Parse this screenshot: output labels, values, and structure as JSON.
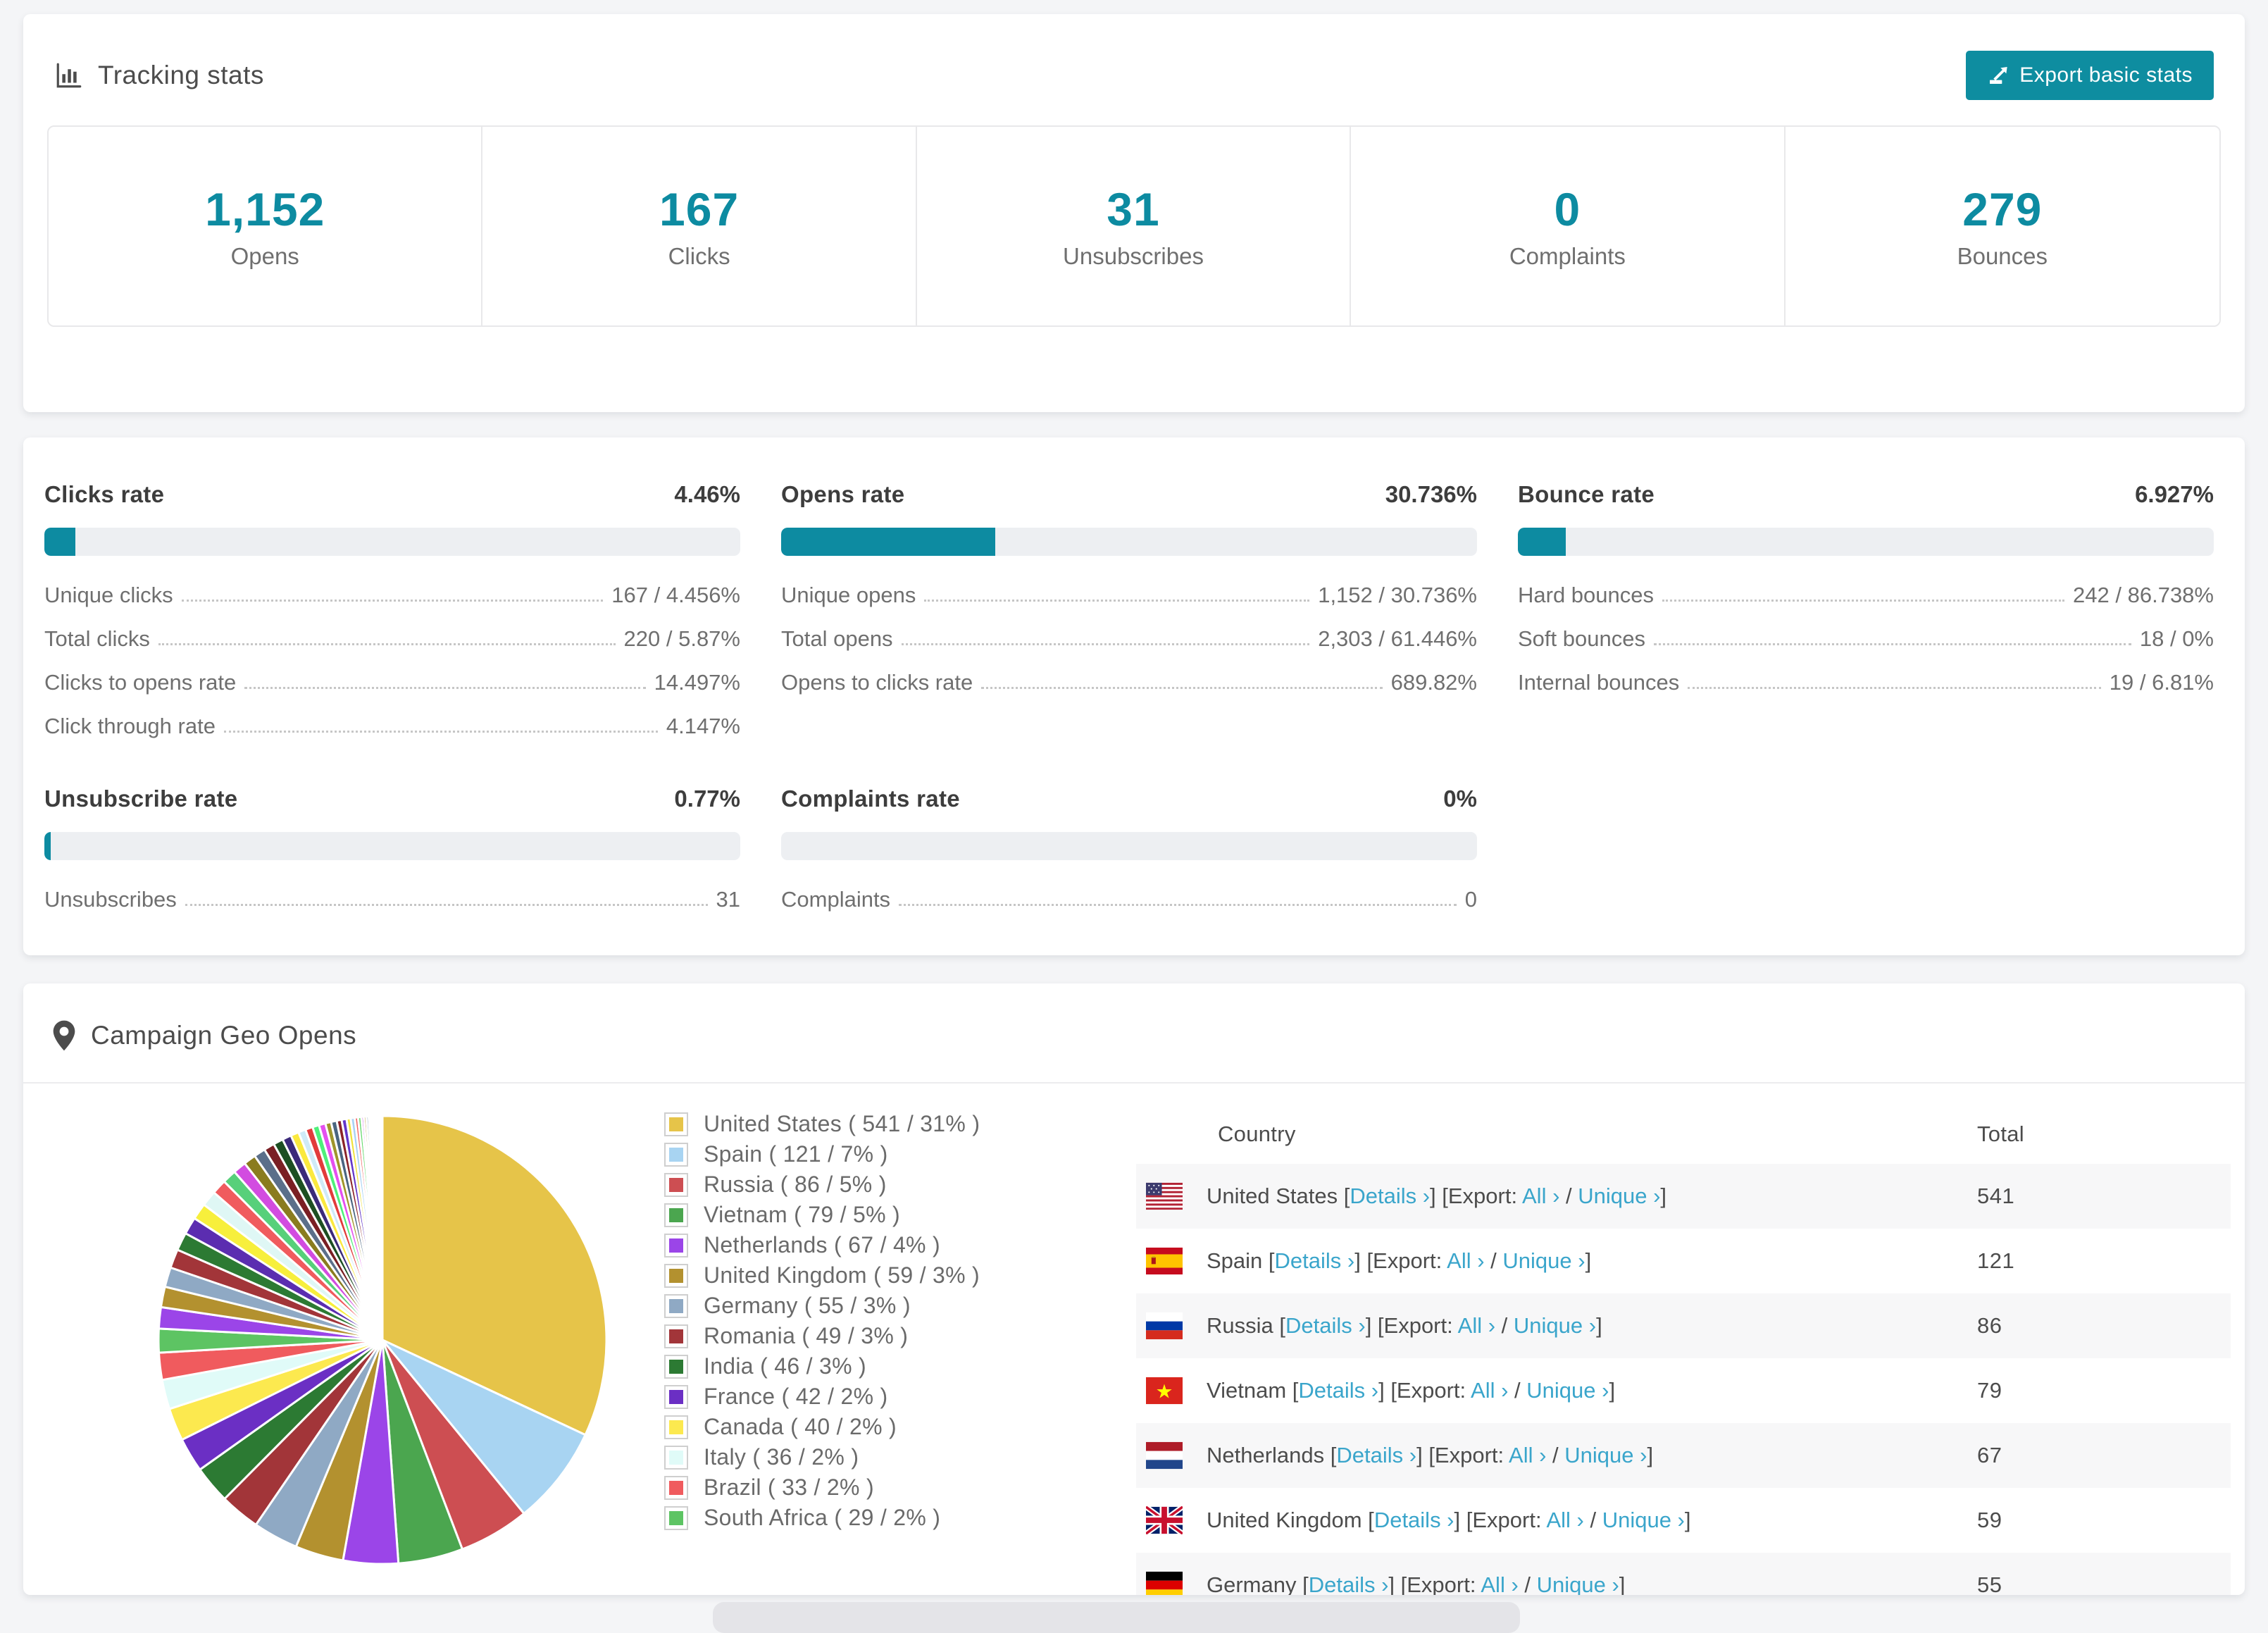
{
  "colors": {
    "accent_teal": "#0d8ba1",
    "button_teal": "#0e8da0",
    "link_blue": "#3aa5cb",
    "bar_track": "#edeff2",
    "page_bg": "#f4f5f7",
    "stripe_bg": "#f7f7f8"
  },
  "tracking_card": {
    "title": "Tracking stats",
    "export_button": "Export basic stats",
    "stats": [
      {
        "value": "1,152",
        "label": "Opens"
      },
      {
        "value": "167",
        "label": "Clicks"
      },
      {
        "value": "31",
        "label": "Unsubscribes"
      },
      {
        "value": "0",
        "label": "Complaints"
      },
      {
        "value": "279",
        "label": "Bounces"
      }
    ]
  },
  "rates_card": {
    "row1": [
      {
        "title": "Clicks rate",
        "value": "4.46%",
        "percent": 4.46,
        "rows": [
          {
            "label": "Unique clicks",
            "value": "167 / 4.456%"
          },
          {
            "label": "Total clicks",
            "value": "220 / 5.87%"
          },
          {
            "label": "Clicks to opens rate",
            "value": "14.497%"
          },
          {
            "label": "Click through rate",
            "value": "4.147%"
          }
        ]
      },
      {
        "title": "Opens rate",
        "value": "30.736%",
        "percent": 30.736,
        "rows": [
          {
            "label": "Unique opens",
            "value": "1,152 / 30.736%"
          },
          {
            "label": "Total opens",
            "value": "2,303 / 61.446%"
          },
          {
            "label": "Opens to clicks rate",
            "value": "689.82%"
          }
        ]
      },
      {
        "title": "Bounce rate",
        "value": "6.927%",
        "percent": 6.927,
        "rows": [
          {
            "label": "Hard bounces",
            "value": "242 / 86.738%"
          },
          {
            "label": "Soft bounces",
            "value": "18 / 0%"
          },
          {
            "label": "Internal bounces",
            "value": "19 / 6.81%"
          }
        ]
      }
    ],
    "row2": [
      {
        "title": "Unsubscribe rate",
        "value": "0.77%",
        "percent": 0.77,
        "rows": [
          {
            "label": "Unsubscribes",
            "value": "31"
          }
        ]
      },
      {
        "title": "Complaints rate",
        "value": "0%",
        "percent": 0,
        "rows": [
          {
            "label": "Complaints",
            "value": "0"
          }
        ]
      }
    ]
  },
  "geo_card": {
    "title": "Campaign Geo Opens",
    "table": {
      "headers": [
        "Country",
        "Total"
      ],
      "link_details": "Details ›",
      "link_export_label": "Export:",
      "link_all": "All ›",
      "link_unique": "Unique ›",
      "rows": [
        {
          "country": "United States",
          "flag": "us",
          "total": "541"
        },
        {
          "country": "Spain",
          "flag": "spain",
          "total": "121"
        },
        {
          "country": "Russia",
          "flag": "russia",
          "total": "86"
        },
        {
          "country": "Vietnam",
          "flag": "vietnam",
          "total": "79"
        },
        {
          "country": "Netherlands",
          "flag": "netherlands",
          "total": "67"
        },
        {
          "country": "United Kingdom",
          "flag": "uk",
          "total": "59"
        },
        {
          "country": "Germany",
          "flag": "germany",
          "total": "55"
        }
      ]
    }
  },
  "chart_data": {
    "type": "pie",
    "title": "Campaign Geo Opens",
    "unit": "opens",
    "legend_position": "right",
    "slices": [
      {
        "label": "United States",
        "value": 541,
        "pct": "31",
        "color": "#e6c449"
      },
      {
        "label": "Spain",
        "value": 121,
        "pct": "7",
        "color": "#a8d4f2"
      },
      {
        "label": "Russia",
        "value": 86,
        "pct": "5",
        "color": "#cd4e52"
      },
      {
        "label": "Vietnam",
        "value": 79,
        "pct": "5",
        "color": "#4ba64f"
      },
      {
        "label": "Netherlands",
        "value": 67,
        "pct": "4",
        "color": "#9b45e8"
      },
      {
        "label": "United Kingdom",
        "value": 59,
        "pct": "3",
        "color": "#b3912f"
      },
      {
        "label": "Germany",
        "value": 55,
        "pct": "3",
        "color": "#8fa9c4"
      },
      {
        "label": "Romania",
        "value": 49,
        "pct": "3",
        "color": "#a23539"
      },
      {
        "label": "India",
        "value": 46,
        "pct": "3",
        "color": "#2c7a33"
      },
      {
        "label": "France",
        "value": 42,
        "pct": "2",
        "color": "#6b2fc4"
      },
      {
        "label": "Canada",
        "value": 40,
        "pct": "2",
        "color": "#fce94f"
      },
      {
        "label": "Italy",
        "value": 36,
        "pct": "2",
        "color": "#e0fbf8"
      },
      {
        "label": "Brazil",
        "value": 33,
        "pct": "2",
        "color": "#f05b5e"
      },
      {
        "label": "South Africa",
        "value": 29,
        "pct": "2",
        "color": "#5dc463"
      }
    ],
    "others_values": [
      26,
      25,
      24,
      23,
      22,
      21,
      20,
      19,
      18,
      17,
      16,
      15,
      14,
      13,
      12,
      11,
      10,
      9,
      9,
      8,
      8,
      7,
      7,
      6,
      6,
      5,
      5,
      4,
      4,
      3,
      3,
      3,
      2,
      2,
      2,
      2,
      1,
      1,
      1,
      1,
      1,
      0.8,
      0.7,
      0.6,
      0.5,
      0.4,
      0.3,
      0.2
    ],
    "others_palette": [
      "#9b45e8",
      "#b3912f",
      "#8fa9c4",
      "#a23539",
      "#2c7a33",
      "#5b2db0",
      "#f7ef3c",
      "#dff7f5",
      "#f05b5e",
      "#57d07a",
      "#d24ce0",
      "#8a7c1f",
      "#5b6f8a",
      "#7a1f24",
      "#1d4f22",
      "#3b2a7a",
      "#fbe93e",
      "#cfeaf7",
      "#e23b3b",
      "#4ef07a",
      "#e44ff0",
      "#a0952b",
      "#4a6580",
      "#8a2328",
      "#6236c9",
      "#efe23a",
      "#a8d2f4",
      "#f26060",
      "#66d96e",
      "#c14ce0",
      "#b3912f",
      "#8fa9c4",
      "#a23539",
      "#2c7a33",
      "#5b2db0",
      "#f7ef3c",
      "#dff7f5",
      "#f05b5e",
      "#57d07a",
      "#d24ce0",
      "#8a7c1f",
      "#5b6f8a",
      "#7a1f24",
      "#1d4f22",
      "#3b2a7a",
      "#fbe93e",
      "#cfeaf7",
      "#e23b3b"
    ]
  }
}
